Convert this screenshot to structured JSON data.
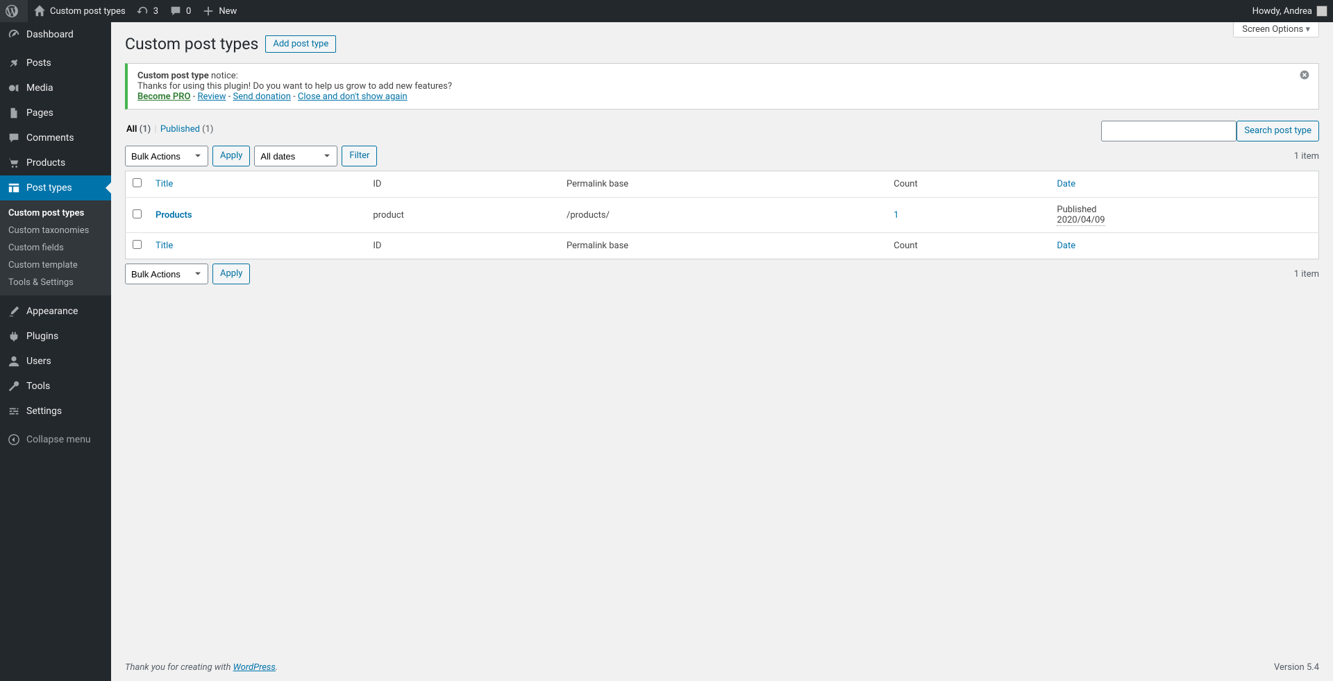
{
  "adminbar": {
    "site_name": "Custom post types",
    "updates": "3",
    "comments": "0",
    "new": "New",
    "howdy": "Howdy, Andrea"
  },
  "sidebar": {
    "items": [
      {
        "label": "Dashboard"
      },
      {
        "label": "Posts"
      },
      {
        "label": "Media"
      },
      {
        "label": "Pages"
      },
      {
        "label": "Comments"
      },
      {
        "label": "Products"
      },
      {
        "label": "Post types"
      },
      {
        "label": "Appearance"
      },
      {
        "label": "Plugins"
      },
      {
        "label": "Users"
      },
      {
        "label": "Tools"
      },
      {
        "label": "Settings"
      },
      {
        "label": "Collapse menu"
      }
    ],
    "submenu": [
      {
        "label": "Custom post types"
      },
      {
        "label": "Custom taxonomies"
      },
      {
        "label": "Custom fields"
      },
      {
        "label": "Custom template"
      },
      {
        "label": "Tools & Settings"
      }
    ]
  },
  "page": {
    "screen_options": "Screen Options",
    "heading": "Custom post types",
    "add_button": "Add post type"
  },
  "notice": {
    "strong": "Custom post type",
    "suffix": " notice:",
    "line2": "Thanks for using this plugin! Do you want to help us grow to add new features?",
    "links": {
      "pro": "Become PRO",
      "review": "Review",
      "donate": "Send donation",
      "close": "Close and don't show again"
    },
    "sep": " - "
  },
  "filters": {
    "all_label": "All",
    "all_count": "(1)",
    "published_label": "Published",
    "published_count": "(1)"
  },
  "search": {
    "button": "Search post type"
  },
  "tablenav": {
    "bulk_actions": "Bulk Actions",
    "apply": "Apply",
    "all_dates": "All dates",
    "filter": "Filter",
    "item_count": "1 item"
  },
  "table": {
    "columns": {
      "title": "Title",
      "id": "ID",
      "permalink": "Permalink base",
      "count": "Count",
      "date": "Date"
    },
    "rows": [
      {
        "title": "Products",
        "id": "product",
        "permalink": "/products/",
        "count": "1",
        "date_status": "Published",
        "date_value": "2020/04/09"
      }
    ]
  },
  "footer": {
    "thank_you_prefix": "Thank you for creating with ",
    "wordpress": "WordPress",
    "thank_you_suffix": ".",
    "version": "Version 5.4"
  }
}
